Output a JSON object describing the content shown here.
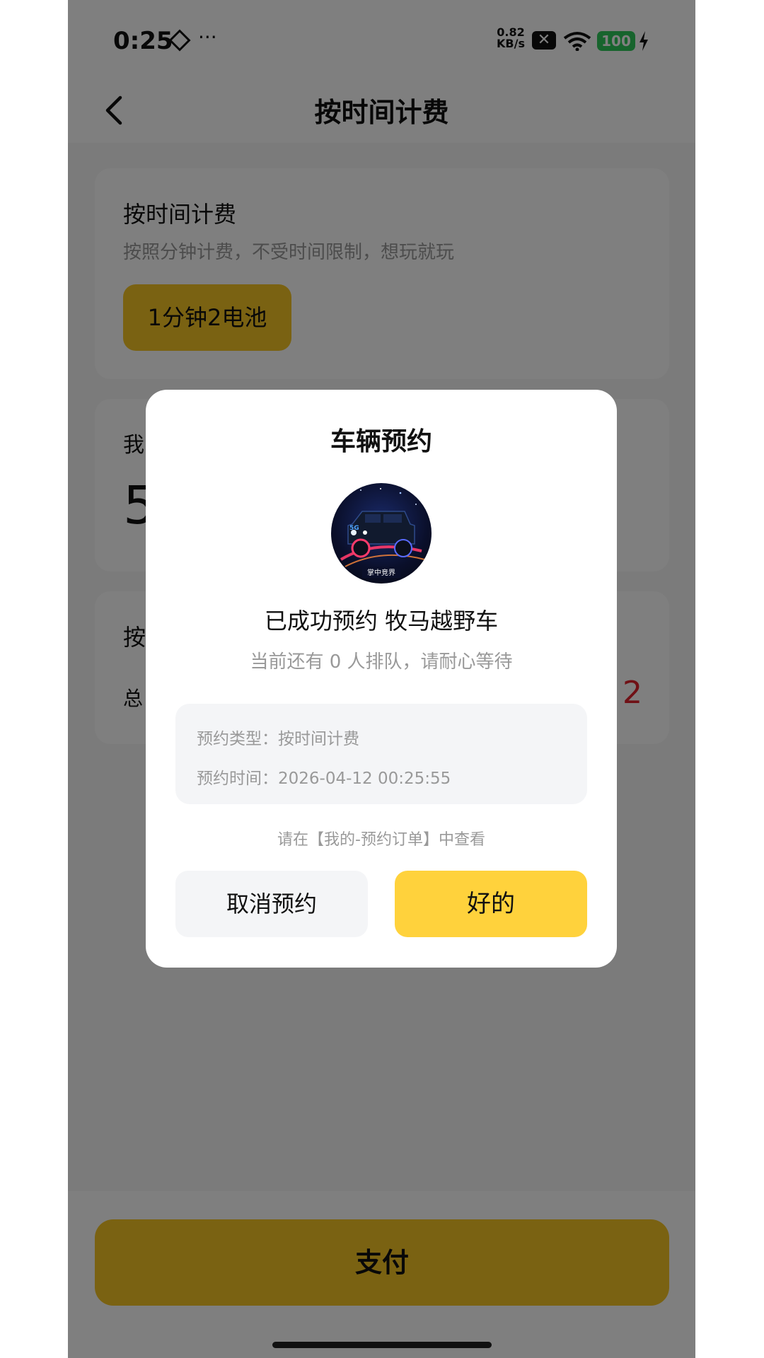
{
  "status_bar": {
    "time": "0:25",
    "net_speed_value": "0.82",
    "net_speed_unit": "KB/s",
    "battery": "100",
    "extra": "···"
  },
  "header": {
    "title": "按时间计费"
  },
  "card_billing": {
    "title": "按时间计费",
    "description": "按照分钟计费，不受时间限制，想玩就玩",
    "price_chip": "1分钟2电池"
  },
  "card_balance": {
    "label_partial": "我",
    "value_partial": "5"
  },
  "card_summary": {
    "title_partial": "按",
    "total_label_partial": "总",
    "total_value_partial": "2"
  },
  "pay_button": "支付",
  "modal": {
    "title": "车辆预约",
    "avatar_caption": "掌中竞界",
    "avatar_badge": "5G",
    "success_text": "已成功预约 牧马越野车",
    "queue_text": "当前还有 0 人排队，请耐心等待",
    "reservation_type": "预约类型：按时间计费",
    "reservation_time": "预约时间：2026-04-12 00:25:55",
    "hint": "请在【我的-预约订单】中查看",
    "cancel_label": "取消预约",
    "ok_label": "好的"
  },
  "colors": {
    "accent": "#f5c424",
    "ok_button": "#ffd23c",
    "price_red": "#e0232d",
    "battery_green": "#2fc85a"
  }
}
